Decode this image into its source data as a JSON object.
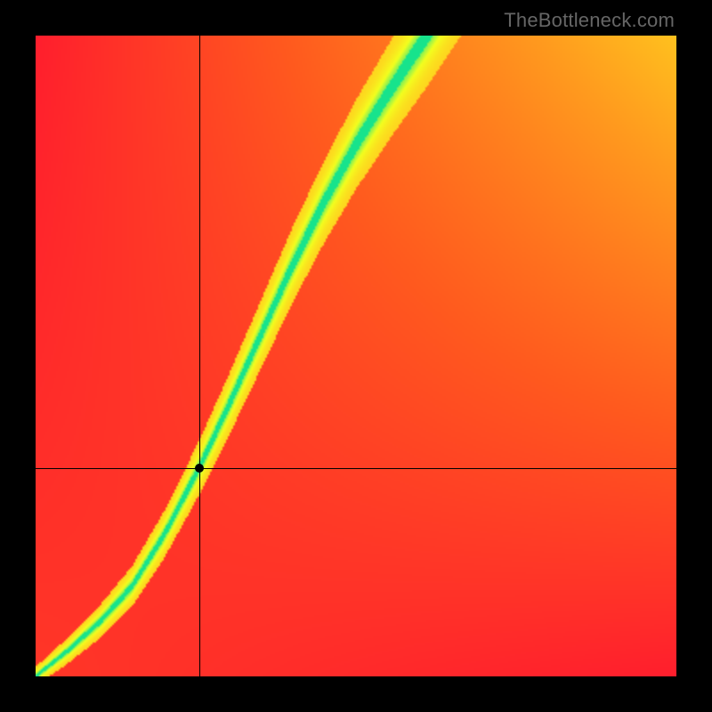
{
  "watermark": "TheBottleneck.com",
  "chart_data": {
    "type": "heatmap",
    "title": "",
    "xlabel": "",
    "ylabel": "",
    "xlim": [
      0,
      1
    ],
    "ylim": [
      0,
      1
    ],
    "crosshair": {
      "x": 0.255,
      "y": 0.325
    },
    "marker": {
      "x": 0.255,
      "y": 0.325
    },
    "ridge": {
      "description": "optimum curve; fitness = 1 along this path from bottom-left toward upper-middle-right",
      "points": [
        [
          0.0,
          0.0
        ],
        [
          0.05,
          0.04
        ],
        [
          0.1,
          0.085
        ],
        [
          0.15,
          0.14
        ],
        [
          0.2,
          0.22
        ],
        [
          0.255,
          0.325
        ],
        [
          0.3,
          0.42
        ],
        [
          0.35,
          0.53
        ],
        [
          0.4,
          0.64
        ],
        [
          0.45,
          0.74
        ],
        [
          0.5,
          0.83
        ],
        [
          0.55,
          0.91
        ],
        [
          0.61,
          1.0
        ]
      ],
      "half_width_start": 0.01,
      "half_width_end": 0.055
    },
    "colorscale": [
      {
        "t": 0.0,
        "color": "#FF1E2D"
      },
      {
        "t": 0.25,
        "color": "#FF5A1E"
      },
      {
        "t": 0.5,
        "color": "#FF9A1E"
      },
      {
        "t": 0.7,
        "color": "#FFD21E"
      },
      {
        "t": 0.85,
        "color": "#F3FF1E"
      },
      {
        "t": 1.0,
        "color": "#17E38C"
      }
    ],
    "primary_corner_heat": {
      "bottom_left": 0.1,
      "top_left": 0.0,
      "bottom_right": 0.0,
      "top_right": 0.64
    }
  }
}
